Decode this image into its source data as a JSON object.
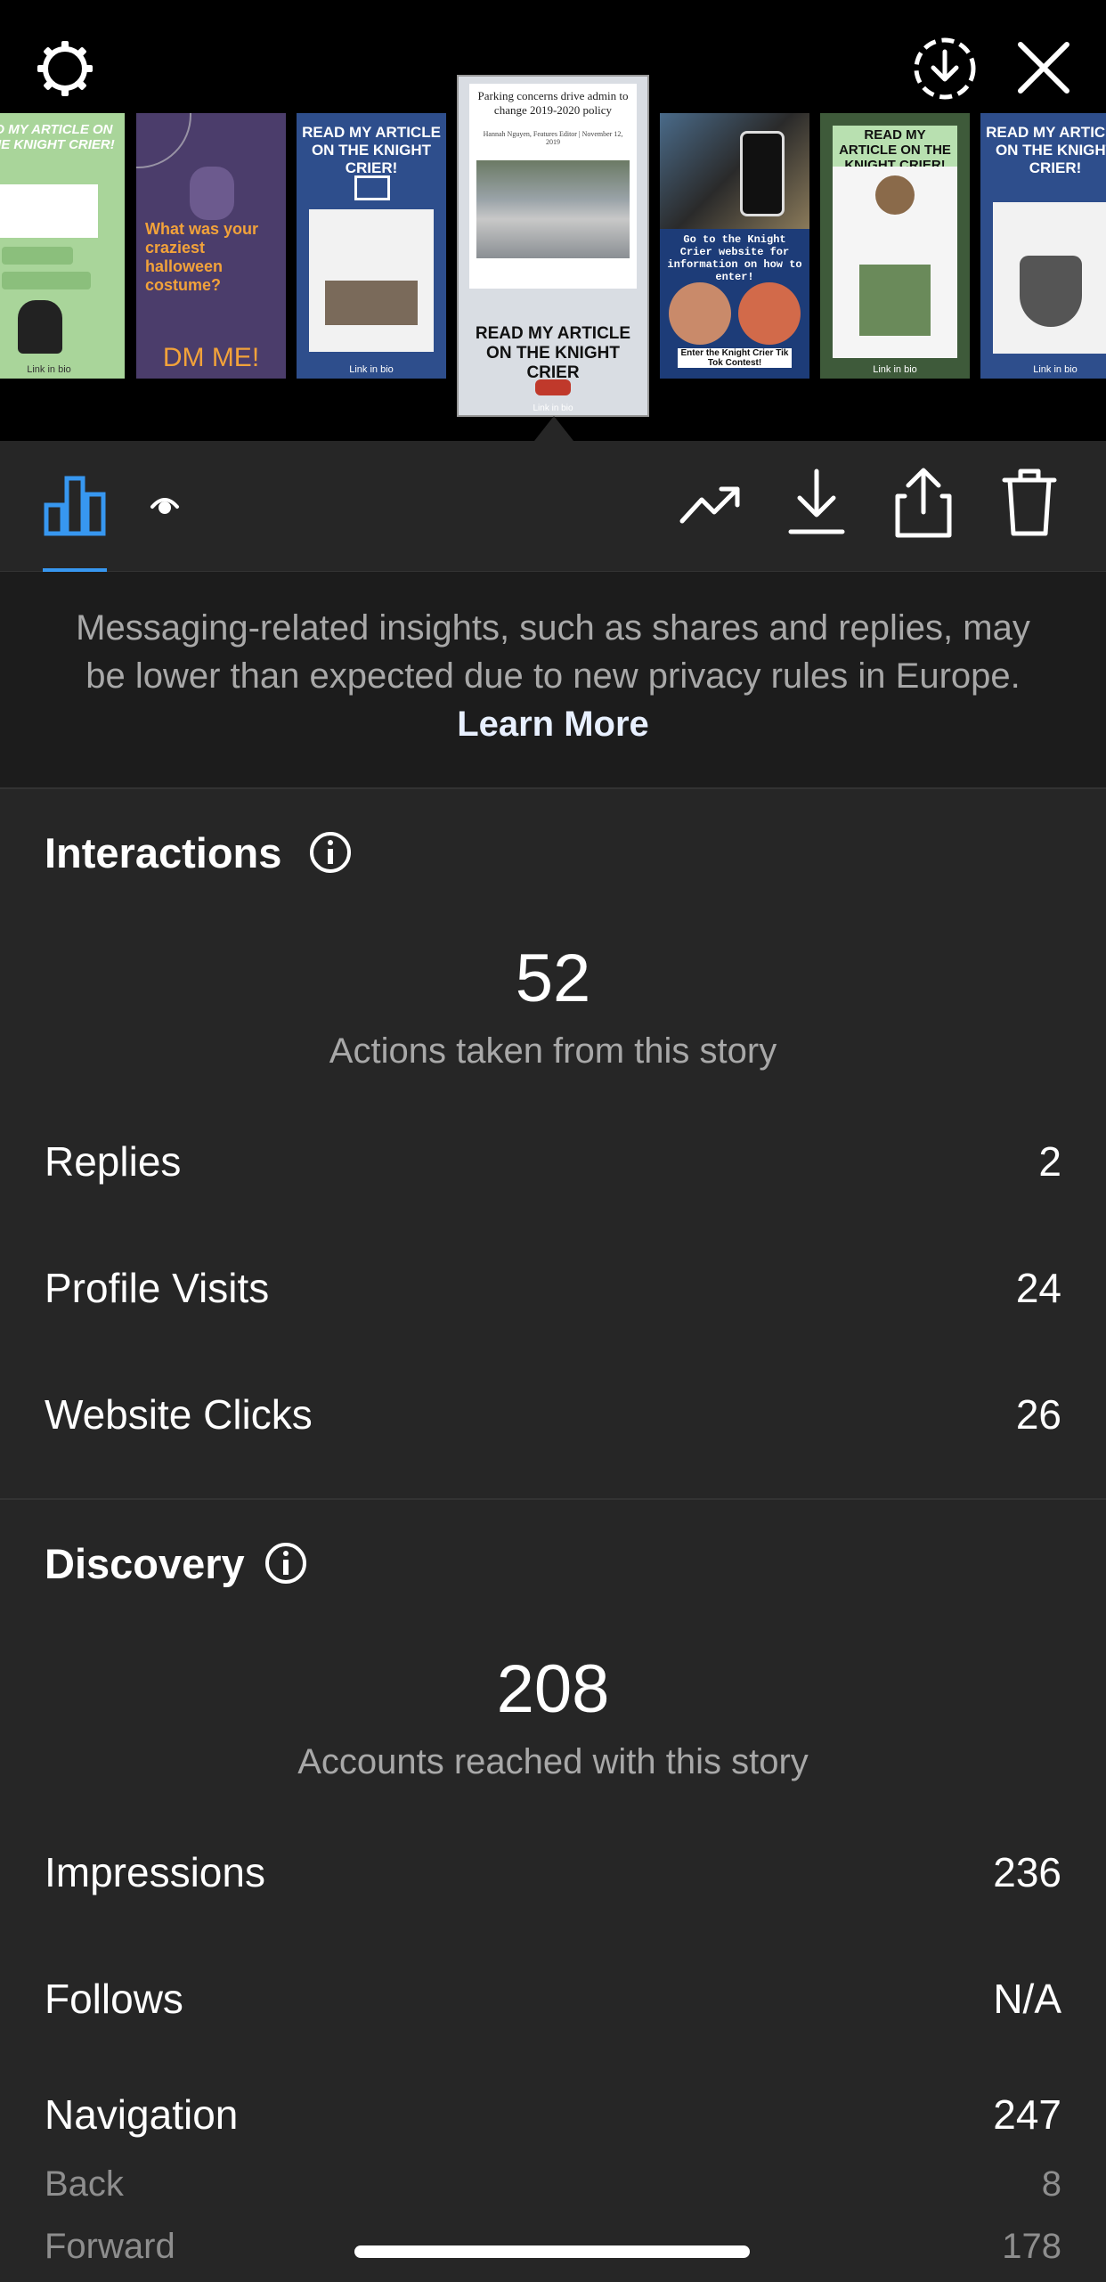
{
  "colors": {
    "accent": "#3797f0",
    "background": "#262626",
    "notice_bg": "#1c1c1c",
    "muted": "#a8a8a8"
  },
  "top_bar": {
    "settings_icon": "gear-icon",
    "save_icon": "download-circle-icon",
    "close_icon": "close-icon"
  },
  "thumbnails": [
    {
      "caption": "AD MY ARTICLE ON THE KNIGHT CRIER!",
      "footer": "Link in bio"
    },
    {
      "caption": "What was your craziest halloween costume?",
      "footer": "DM ME!"
    },
    {
      "caption": "READ MY ARTICLE ON THE KNIGHT CRIER!",
      "footer": "Link in bio"
    },
    {
      "caption": "Parking concerns drive admin to change 2019-2020 policy",
      "byline": "Hannah Nguyen, Features Editor | November 12, 2019",
      "footer": "READ MY ARTICLE ON THE KNIGHT CRIER",
      "link": "Link in bio"
    },
    {
      "caption": "Go to the Knight Crier website for information on how to enter!",
      "footer": "Enter the Knight Crier Tik Tok Contest!"
    },
    {
      "caption": "READ MY ARTICLE ON THE KNIGHT CRIER!",
      "footer": "Link in bio"
    },
    {
      "caption": "READ MY ARTICLE ON THE KNIGHT CRIER!",
      "footer": "Link in bio"
    }
  ],
  "toolbar": {
    "insights_icon": "bar-chart-icon",
    "viewers_icon": "eye-icon",
    "promote_icon": "trending-up-icon",
    "download_icon": "download-icon",
    "share_icon": "share-icon",
    "delete_icon": "trash-icon"
  },
  "notice": {
    "text": "Messaging-related insights, such as shares and replies, may be lower than expected due to new privacy rules in Europe.",
    "link": "Learn More"
  },
  "interactions": {
    "title": "Interactions",
    "total": "52",
    "total_label": "Actions taken from this story",
    "rows": [
      {
        "label": "Replies",
        "value": "2"
      },
      {
        "label": "Profile Visits",
        "value": "24"
      },
      {
        "label": "Website Clicks",
        "value": "26"
      }
    ]
  },
  "discovery": {
    "title": "Discovery",
    "total": "208",
    "total_label": "Accounts reached with this story",
    "rows": [
      {
        "label": "Impressions",
        "value": "236"
      },
      {
        "label": "Follows",
        "value": "N/A"
      },
      {
        "label": "Navigation",
        "value": "247"
      }
    ],
    "sub_rows": [
      {
        "label": "Back",
        "value": "8"
      },
      {
        "label": "Forward",
        "value": "178"
      }
    ]
  }
}
